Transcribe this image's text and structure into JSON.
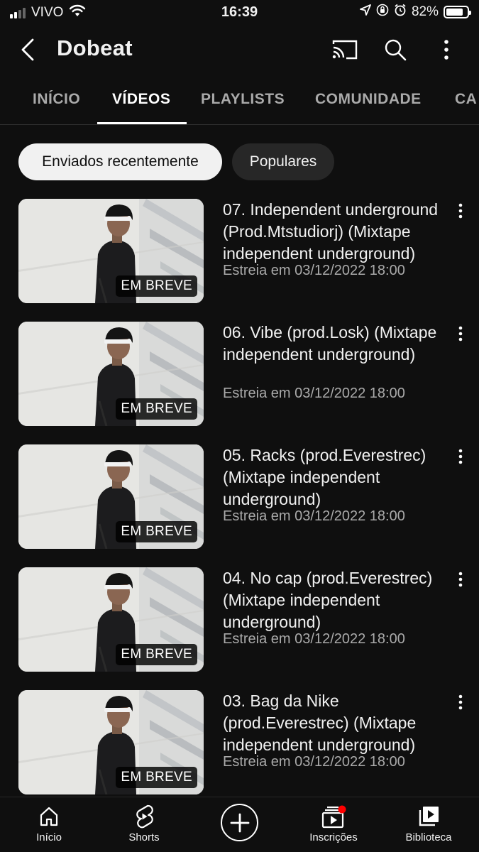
{
  "status_bar": {
    "carrier": "VIVO",
    "time": "16:39",
    "battery": "82%",
    "battery_level": 0.82
  },
  "header": {
    "channel_name": "Dobeat",
    "icons": [
      "back-arrow-icon",
      "cast-icon",
      "search-icon",
      "more-vertical-icon"
    ]
  },
  "tabs": [
    {
      "label": "INÍCIO",
      "active": false
    },
    {
      "label": "VÍDEOS",
      "active": true
    },
    {
      "label": "PLAYLISTS",
      "active": false
    },
    {
      "label": "COMUNIDADE",
      "active": false
    },
    {
      "label": "CA",
      "active": false
    }
  ],
  "chips": [
    {
      "label": "Enviados recentemente",
      "selected": true
    },
    {
      "label": "Populares",
      "selected": false
    }
  ],
  "videos": [
    {
      "title": "07. Independent underground (Prod.Mtstudiorj) (Mixtape independent underground)",
      "meta": "Estreia em 03/12/2022 18:00",
      "badge": "EM BREVE"
    },
    {
      "title": "06. Vibe (prod.Losk) (Mixtape independent underground)",
      "meta": "Estreia em 03/12/2022 18:00",
      "badge": "EM BREVE"
    },
    {
      "title": "05. Racks (prod.Everestrec) (Mixtape independent underground)",
      "meta": "Estreia em 03/12/2022 18:00",
      "badge": "EM BREVE"
    },
    {
      "title": "04. No cap (prod.Everestrec) (Mixtape independent underground)",
      "meta": "Estreia em 03/12/2022 18:00",
      "badge": "EM BREVE"
    },
    {
      "title": "03. Bag da Nike (prod.Everestrec) (Mixtape independent underground)",
      "meta": "Estreia em 03/12/2022 18:00",
      "badge": "EM BREVE"
    }
  ],
  "bottom_nav": [
    {
      "label": "Início",
      "icon": "home-icon"
    },
    {
      "label": "Shorts",
      "icon": "shorts-icon"
    },
    {
      "label": "",
      "icon": "create-plus-icon"
    },
    {
      "label": "Inscrições",
      "icon": "subscriptions-icon"
    },
    {
      "label": "Biblioteca",
      "icon": "library-icon"
    }
  ],
  "colors": {
    "background": "#0f0f0f",
    "chip_selected": "#f1f1f1",
    "chip_default": "#272727",
    "notification_dot": "#ff0000",
    "secondary_text": "#aaaaaa"
  }
}
